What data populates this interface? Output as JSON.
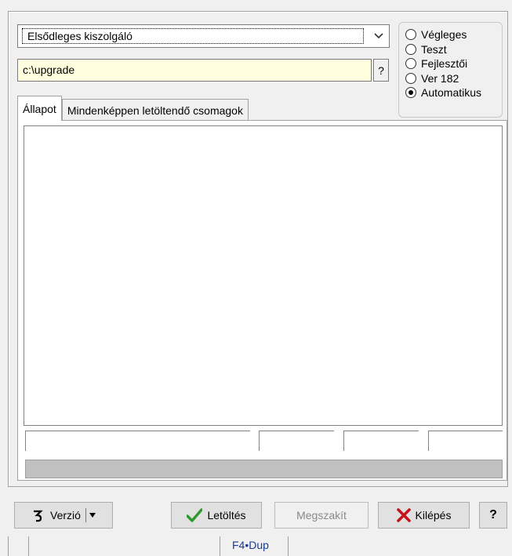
{
  "server_combo": {
    "selected": "Elsődleges kiszolgáló"
  },
  "path": {
    "value": "c:\\upgrade",
    "help_label": "?"
  },
  "mode_radios": [
    {
      "label": "Végleges",
      "selected": false
    },
    {
      "label": "Teszt",
      "selected": false
    },
    {
      "label": "Fejlesztői",
      "selected": false
    },
    {
      "label": "Ver 182",
      "selected": false
    },
    {
      "label": "Automatikus",
      "selected": true
    }
  ],
  "tabs": [
    {
      "label": "Állapot",
      "active": true
    },
    {
      "label": "Mindenképpen letöltendő csomagok",
      "active": false
    }
  ],
  "buttons": {
    "version": "Verzió",
    "download": "Letöltés",
    "abort": "Megszakít",
    "exit": "Kilépés",
    "help": "?"
  },
  "statusbar": {
    "shortcut": "F4•Dup"
  },
  "colors": {
    "path_bg": "#ffffe0",
    "download_check": "#2e9a2e",
    "exit_x": "#c4141c",
    "status_text": "#1a3c9a"
  }
}
